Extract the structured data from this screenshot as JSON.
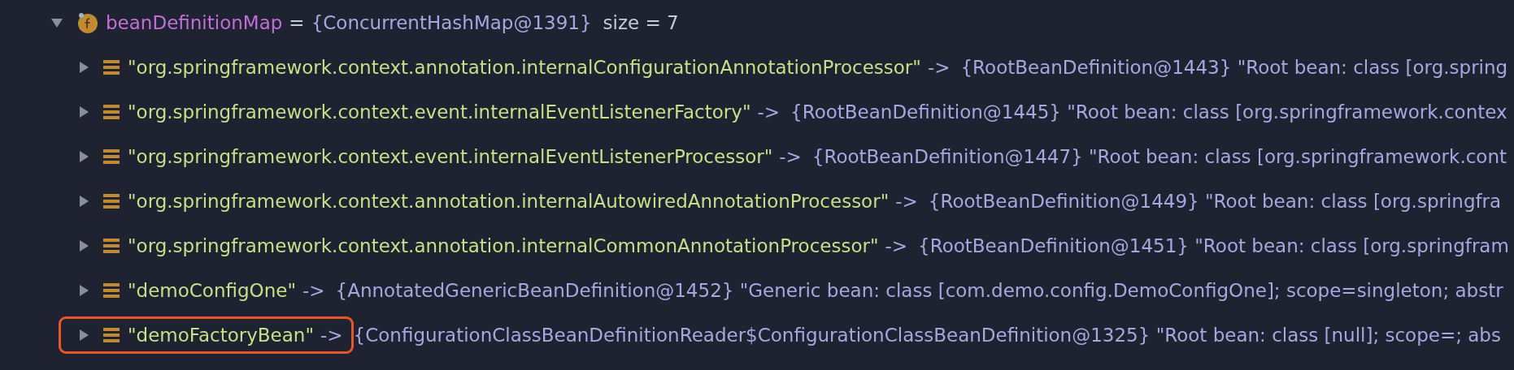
{
  "variable": {
    "name": "beanDefinitionMap",
    "operator": "=",
    "value": "{ConcurrentHashMap@1391}",
    "size": "size = 7",
    "expanded": true,
    "children": [
      {
        "key": "\"org.springframework.context.annotation.internalConfigurationAnnotationProcessor\"",
        "operator": "->",
        "value": "{RootBeanDefinition@1443} \"Root bean: class [org.spring",
        "expanded": false,
        "highlighted": false
      },
      {
        "key": "\"org.springframework.context.event.internalEventListenerFactory\"",
        "operator": "->",
        "value": "{RootBeanDefinition@1445} \"Root bean: class [org.springframework.contex",
        "expanded": false,
        "highlighted": false
      },
      {
        "key": "\"org.springframework.context.event.internalEventListenerProcessor\"",
        "operator": "->",
        "value": "{RootBeanDefinition@1447} \"Root bean: class [org.springframework.cont",
        "expanded": false,
        "highlighted": false
      },
      {
        "key": "\"org.springframework.context.annotation.internalAutowiredAnnotationProcessor\"",
        "operator": "->",
        "value": "{RootBeanDefinition@1449} \"Root bean: class [org.springfra",
        "expanded": false,
        "highlighted": false
      },
      {
        "key": "\"org.springframework.context.annotation.internalCommonAnnotationProcessor\"",
        "operator": "->",
        "value": "{RootBeanDefinition@1451} \"Root bean: class [org.springfram",
        "expanded": false,
        "highlighted": false
      },
      {
        "key": "\"demoConfigOne\"",
        "operator": "->",
        "value": "{AnnotatedGenericBeanDefinition@1452} \"Generic bean: class [com.demo.config.DemoConfigOne]; scope=singleton; abstr",
        "expanded": false,
        "highlighted": false
      },
      {
        "key": "\"demoFactoryBean\"",
        "operator": "->",
        "value": "{ConfigurationClassBeanDefinitionReader$ConfigurationClassBeanDefinition@1325} \"Root bean: class [null]; scope=; abs",
        "expanded": false,
        "highlighted": true
      }
    ]
  }
}
